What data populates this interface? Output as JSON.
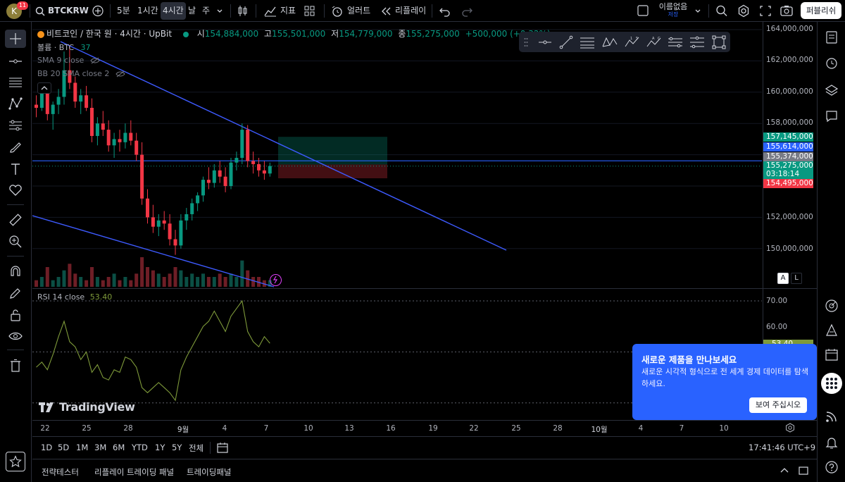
{
  "topbar": {
    "avatar_letter": "K",
    "notification_count": "11",
    "symbol": "BTCKRW",
    "intervals": [
      "5분",
      "1시간",
      "4시간",
      "날",
      "주"
    ],
    "active_interval": "4시간",
    "indicators_label": "지표",
    "alert_label": "얼러트",
    "replay_label": "리플레이",
    "layout_name": "이름없음",
    "layout_status": "저장",
    "publish_label": "퍼블리쉬"
  },
  "legend": {
    "title": "비트코인 / 한국 원 · 4시간 · UpBit",
    "open_label": "시",
    "open": "154,884,000",
    "high_label": "고",
    "high": "155,501,000",
    "low_label": "저",
    "low": "154,779,000",
    "close_label": "종",
    "close": "155,275,000",
    "change": "+500,000 (+0.32%)",
    "volume": "볼륨 · BTC",
    "volume_value": "37",
    "sma": "SMA 9 close",
    "bb": "BB 20 SMA close 2"
  },
  "price_scale": {
    "labels": [
      "164,000,000",
      "162,000,000",
      "160,000,000",
      "158,000,000",
      "152,000,000",
      "150,000,000"
    ],
    "tag_target": "157,145,000",
    "tag_blue_line": "155,614,000",
    "tag_gray": "155,374,000",
    "tag_last": "155,275,000",
    "tag_countdown": "03:18:14",
    "tag_stop": "154,495,000",
    "auto_label": "A",
    "log_label": "L"
  },
  "rsi": {
    "legend": "RSI 14 close",
    "value": "53.40",
    "labels": [
      "70.00",
      "60.00"
    ],
    "current_tag": "53.40"
  },
  "time_axis": {
    "labels": [
      "22",
      "25",
      "28",
      "9월",
      "4",
      "7",
      "10",
      "13",
      "16",
      "19",
      "22",
      "25",
      "28",
      "10월",
      "4",
      "7",
      "10"
    ]
  },
  "range_bar": {
    "ranges": [
      "1D",
      "5D",
      "1M",
      "3M",
      "6M",
      "YTD",
      "1Y",
      "5Y",
      "전체"
    ],
    "clock": "17:41:46 UTC+9"
  },
  "bottom_panel": {
    "tabs": [
      "전략테스터",
      "리플레이 트레이딩 패널",
      "트레이딩패널"
    ]
  },
  "popup": {
    "title": "새로운 제품을 만나보세요",
    "body": "새로운 시각적 형식으로 전 세계 경제 데이터를 탐색하세요.",
    "button": "보여 주십시오"
  },
  "logo_text": "TradingView",
  "colors": {
    "up": "#089981",
    "down": "#f23645",
    "trendline": "#3d5afe",
    "hline": "#2962ff",
    "rsi": "#7e9a3a",
    "accent": "#2962ff"
  },
  "chart_data": {
    "type": "candlestick",
    "symbol": "BTCKRW",
    "interval": "4시간",
    "ylim": [
      149000000,
      164500000
    ],
    "last_close": 155275000,
    "horizontal_line": 155614000,
    "position": {
      "target": 157145000,
      "entry": 155374000,
      "stop": 154495000
    },
    "candles": [
      [
        159.2,
        159.8,
        158.4,
        159.0
      ],
      [
        159.0,
        160.4,
        158.8,
        160.2
      ],
      [
        160.2,
        160.6,
        158.2,
        158.6
      ],
      [
        158.6,
        159.4,
        157.6,
        159.2
      ],
      [
        159.2,
        160.2,
        158.6,
        159.7
      ],
      [
        159.7,
        162.6,
        159.2,
        161.4
      ],
      [
        161.4,
        163.0,
        160.2,
        160.6
      ],
      [
        160.6,
        161.0,
        159.0,
        159.4
      ],
      [
        159.4,
        160.2,
        158.6,
        159.8
      ],
      [
        159.8,
        160.4,
        158.8,
        159.0
      ],
      [
        159.0,
        159.6,
        156.8,
        157.2
      ],
      [
        157.2,
        158.4,
        156.6,
        158.0
      ],
      [
        158.0,
        158.8,
        157.2,
        157.6
      ],
      [
        157.6,
        158.2,
        156.2,
        156.6
      ],
      [
        156.6,
        157.4,
        155.8,
        157.0
      ],
      [
        157.0,
        157.6,
        156.2,
        156.8
      ],
      [
        156.8,
        158.0,
        156.4,
        157.4
      ],
      [
        157.4,
        158.2,
        156.6,
        156.9
      ],
      [
        156.9,
        157.4,
        155.6,
        156.0
      ],
      [
        156.0,
        156.8,
        152.8,
        153.2
      ],
      [
        153.2,
        153.8,
        151.6,
        152.0
      ],
      [
        152.0,
        152.8,
        151.0,
        151.4
      ],
      [
        151.4,
        152.2,
        150.8,
        151.8
      ],
      [
        151.8,
        152.4,
        151.2,
        151.6
      ],
      [
        151.6,
        152.2,
        150.2,
        150.6
      ],
      [
        150.6,
        151.2,
        149.6,
        150.2
      ],
      [
        150.2,
        152.2,
        150.0,
        151.8
      ],
      [
        151.8,
        152.6,
        151.2,
        152.2
      ],
      [
        152.2,
        153.2,
        151.8,
        152.9
      ],
      [
        152.9,
        153.6,
        152.4,
        153.4
      ],
      [
        153.4,
        154.6,
        153.0,
        154.4
      ],
      [
        154.4,
        155.2,
        153.8,
        154.2
      ],
      [
        154.2,
        155.4,
        153.9,
        155.0
      ],
      [
        155.0,
        155.6,
        154.2,
        154.6
      ],
      [
        154.6,
        155.2,
        153.6,
        154.0
      ],
      [
        154.0,
        155.8,
        153.8,
        155.5
      ],
      [
        155.5,
        156.2,
        155.0,
        155.8
      ],
      [
        155.8,
        158.0,
        155.4,
        157.6
      ],
      [
        157.6,
        157.9,
        155.2,
        155.6
      ],
      [
        155.6,
        156.2,
        154.8,
        155.4
      ],
      [
        155.4,
        155.8,
        154.6,
        155.0
      ],
      [
        155.0,
        155.6,
        154.4,
        154.8
      ],
      [
        154.8,
        155.5,
        154.6,
        155.28
      ]
    ],
    "volumes": [
      2,
      3,
      6,
      2,
      3,
      5,
      7,
      4,
      3,
      2,
      6,
      3,
      2,
      3,
      4,
      2,
      3,
      2,
      4,
      9,
      6,
      5,
      4,
      3,
      4,
      6,
      5,
      3,
      4,
      3,
      4,
      3,
      3,
      4,
      3,
      4,
      3,
      8,
      5,
      3,
      3,
      2,
      2
    ],
    "rsi_values": [
      44,
      46,
      43,
      49,
      56,
      62,
      54,
      52,
      47,
      50,
      42,
      45,
      40,
      39,
      43,
      42,
      48,
      47,
      44,
      36,
      34,
      36,
      38,
      36,
      34,
      31,
      43,
      48,
      52,
      56,
      60,
      62,
      66,
      62,
      58,
      64,
      67,
      70,
      58,
      54,
      52,
      56,
      53.4
    ]
  }
}
